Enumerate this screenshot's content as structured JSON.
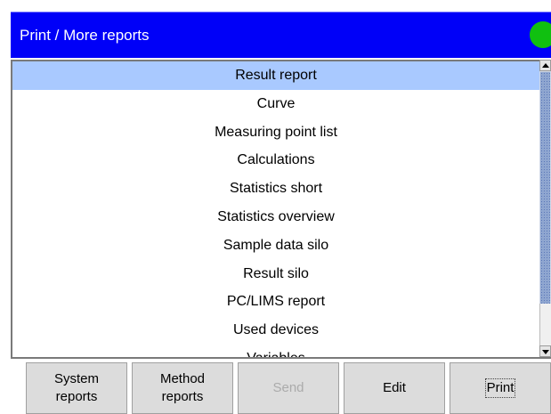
{
  "header": {
    "title": "Print / More reports",
    "status_color": "#10c010"
  },
  "reports": {
    "items": [
      {
        "label": "Result report",
        "selected": true
      },
      {
        "label": "Curve"
      },
      {
        "label": "Measuring point list"
      },
      {
        "label": "Calculations"
      },
      {
        "label": "Statistics short"
      },
      {
        "label": "Statistics overview"
      },
      {
        "label": "Sample data silo"
      },
      {
        "label": "Result silo"
      },
      {
        "label": "PC/LIMS report"
      },
      {
        "label": "Used devices"
      },
      {
        "label": "Variables"
      }
    ]
  },
  "toolbar": {
    "system_reports": "System\nreports",
    "method_reports": "Method\nreports",
    "send": "Send",
    "edit": "Edit",
    "print": "Print"
  },
  "colors": {
    "titlebar": "#0000f8",
    "selection": "#a9c9ff"
  }
}
